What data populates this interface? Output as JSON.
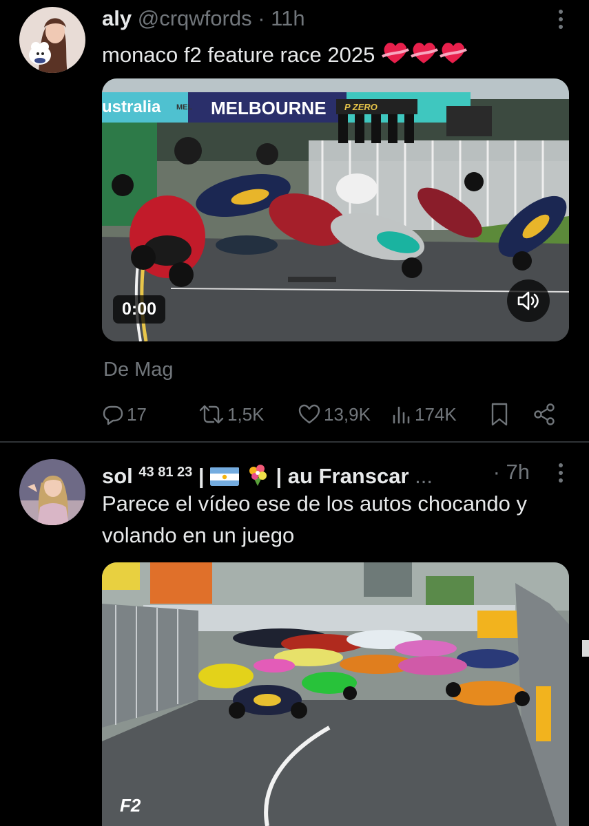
{
  "post1": {
    "name": "aly",
    "handle": "@crqwfords",
    "separator": "·",
    "time": "11h",
    "text": "monaco f2 feature race 2025",
    "video": {
      "timer": "0:00",
      "board_left": "ustralia",
      "board_right": "MELBOURNE",
      "board_small": "MEL",
      "pzero": "P ZERO"
    },
    "source": "De Mag",
    "actions": {
      "replies": "17",
      "reposts": "1,5K",
      "likes": "13,9K",
      "views": "174K"
    }
  },
  "post2": {
    "name": "sol",
    "sup": "43 81 23",
    "bar": "|",
    "bar2": "|",
    "name_rest": "au Franscar",
    "ellipsis": "...",
    "separator": "·",
    "time": "7h",
    "text": "Parece el vídeo ese de los autos chocando y volando en un juego",
    "logo": "F2"
  },
  "colors": {
    "background": "#000000",
    "text": "#e7e9ea",
    "muted": "#71767b",
    "divider": "#2f3336"
  },
  "icons": [
    "more-icon",
    "reply-icon",
    "repost-icon",
    "like-icon",
    "views-icon",
    "bookmark-icon",
    "share-icon",
    "volume-icon",
    "heart-emoji-icon",
    "argentina-flag-icon",
    "bouquet-emoji-icon"
  ]
}
